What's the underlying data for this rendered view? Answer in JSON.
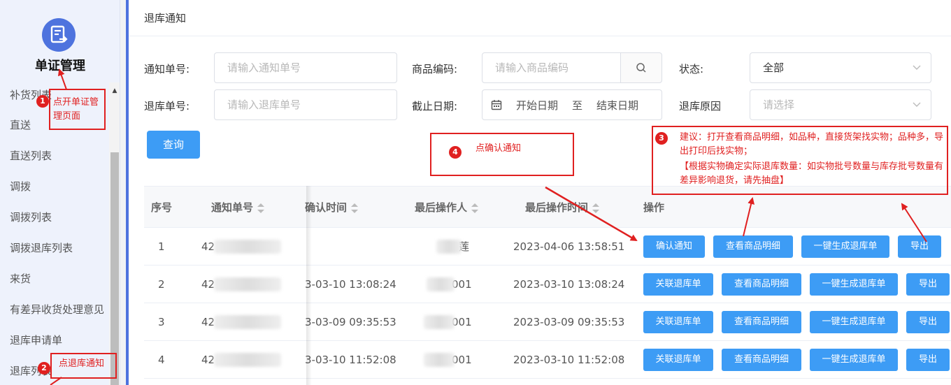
{
  "sidebar": {
    "title": "单证管理",
    "logo_icon": "document-icon",
    "items": [
      "补货列表",
      "直送",
      "直送列表",
      "调拨",
      "调拨列表",
      "调拨退库列表",
      "来货",
      "有差异收货处理意见",
      "退库申请单",
      "退库列表"
    ]
  },
  "page": {
    "title": "退库通知"
  },
  "form": {
    "notice_no_label": "通知单号:",
    "notice_no_placeholder": "请输入通知单号",
    "product_code_label": "商品编码:",
    "product_code_placeholder": "请输入商品编码",
    "status_label": "状态:",
    "status_value": "全部",
    "return_no_label": "退库单号:",
    "return_no_placeholder": "请输入退库单号",
    "deadline_label": "截止日期:",
    "date_start": "开始日期",
    "date_sep": "至",
    "date_end": "结束日期",
    "reason_label": "退库原因",
    "reason_placeholder": "请选择",
    "query_button": "查询"
  },
  "table": {
    "headers": [
      "序号",
      "通知单号",
      "确认时间",
      "最后操作人",
      "最后操作时间",
      "操作"
    ],
    "rows": [
      {
        "index": "1",
        "notice_no": "42",
        "confirm_time": "",
        "operator": "莲",
        "op_time": "2023-04-06 13:58:51",
        "actions": [
          "确认通知",
          "查看商品明细",
          "一键生成退库单",
          "导出"
        ]
      },
      {
        "index": "2",
        "notice_no": "42",
        "confirm_time": "3-03-10 13:08:24",
        "operator": "001",
        "op_time": "2023-03-10 13:08:24",
        "actions": [
          "关联退库单",
          "查看商品明细",
          "一键生成退库单",
          "导出"
        ]
      },
      {
        "index": "3",
        "notice_no": "42",
        "confirm_time": "3-03-09 09:35:53",
        "operator": "001",
        "op_time": "2023-03-09 09:35:53",
        "actions": [
          "关联退库单",
          "查看商品明细",
          "一键生成退库单",
          "导出"
        ]
      },
      {
        "index": "4",
        "notice_no": "42",
        "confirm_time": "3-03-10 11:52:08",
        "operator": "001",
        "op_time": "2023-03-10 11:52:08",
        "actions": [
          "关联退库单",
          "查看商品明细",
          "一键生成退库单",
          "导出"
        ]
      }
    ]
  },
  "annotations": {
    "a1_num": "1",
    "a1_text": "点开单证管理页面",
    "a2_num": "2",
    "a2_text": "点退库通知",
    "a3_num": "3",
    "a3_line1": "建议：打开查看商品明细，如品种，直接货架找实物；品种多，导出打印后找实物；",
    "a3_line2": "【根据实物确定实际退库数量：如实物批号数量与库存批号数量有差异影响退货，请先抽盘】",
    "a4_num": "4",
    "a4_text": "点确认通知",
    "color": "#e02020"
  },
  "colors": {
    "accent": "#3d9cf5",
    "sidebar_bg": "#eef2fc",
    "brand": "#4e73de"
  }
}
